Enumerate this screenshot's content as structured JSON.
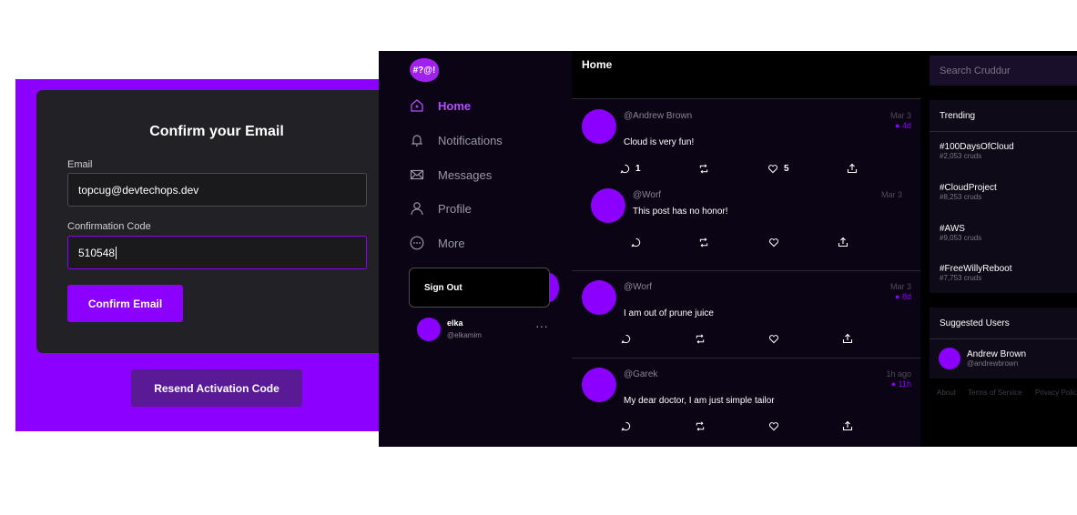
{
  "confirm": {
    "title": "Confirm your Email",
    "email_label": "Email",
    "email_value": "topcug@devtechops.dev",
    "code_label": "Confirmation Code",
    "code_value": "510548",
    "confirm_button": "Confirm Email",
    "resend_button": "Resend Activation Code"
  },
  "app": {
    "logo_text": "#?@!",
    "nav": [
      {
        "label": "Home",
        "icon": "home-icon"
      },
      {
        "label": "Notifications",
        "icon": "bell-icon"
      },
      {
        "label": "Messages",
        "icon": "mail-icon"
      },
      {
        "label": "Profile",
        "icon": "user-icon"
      },
      {
        "label": "More",
        "icon": "more-circle-icon"
      }
    ],
    "signout_label": "Sign Out",
    "profile": {
      "name": "elka",
      "handle": "@elkamim",
      "more": "···"
    },
    "feed_title": "Home",
    "posts": [
      {
        "handle": "@Andrew Brown",
        "time_posted": "Mar 3",
        "time_ago": "4d",
        "message": "Cloud is very fun!",
        "reply_count": "1",
        "like_count": "5"
      },
      {
        "handle": "@Worf",
        "time_posted": "Mar 3",
        "time_ago": "",
        "message": "This post has no honor!",
        "reply_count": "",
        "like_count": ""
      },
      {
        "handle": "@Worf",
        "time_posted": "Mar 3",
        "time_ago": "8d",
        "message": "I am out of prune juice",
        "reply_count": "",
        "like_count": ""
      },
      {
        "handle": "@Garek",
        "time_posted": "1h ago",
        "time_ago": "11h",
        "message": "My dear doctor, I am just simple tailor",
        "reply_count": "",
        "like_count": ""
      }
    ],
    "search_placeholder": "Search Cruddur",
    "trending_title": "Trending",
    "trending": [
      {
        "tag": "#100DaysOfCloud",
        "count": "#2,053 cruds"
      },
      {
        "tag": "#CloudProject",
        "count": "#8,253 cruds"
      },
      {
        "tag": "#AWS",
        "count": "#9,053 cruds"
      },
      {
        "tag": "#FreeWillyReboot",
        "count": "#7,753 cruds"
      }
    ],
    "suggested_title": "Suggested Users",
    "suggested": [
      {
        "name": "Andrew Brown",
        "handle": "@andrewbrown"
      }
    ],
    "footer_links": [
      "About",
      "Terms of Service",
      "Privacy Policy"
    ]
  },
  "colors": {
    "accent": "#8c00ff",
    "resend": "#5a1a95",
    "card": "#222226"
  }
}
